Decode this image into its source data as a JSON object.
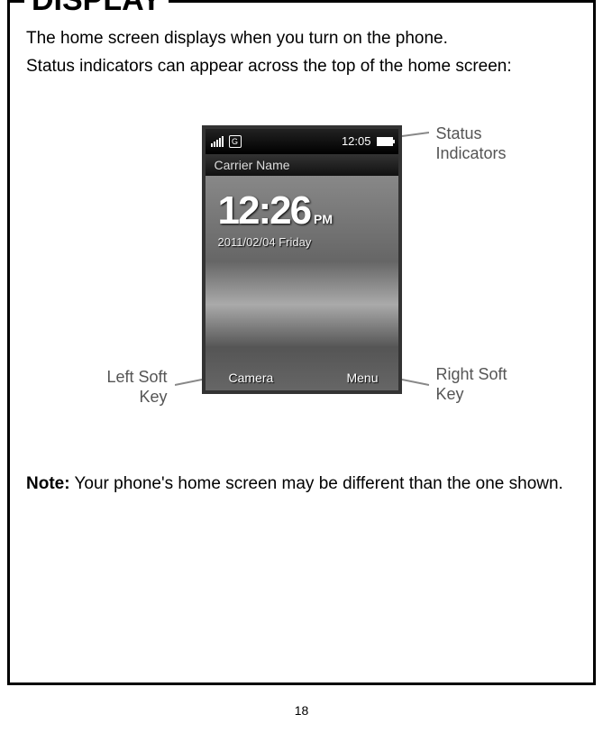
{
  "heading": "DISPLAY",
  "intro_line1": "The home screen displays when you turn on the phone.",
  "intro_line2": "Status indicators can appear across the top of the home screen:",
  "labels": {
    "status_indicators_l1": "Status",
    "status_indicators_l2": "Indicators",
    "left_soft_l1": "Left Soft",
    "left_soft_l2": "Key",
    "right_soft_l1": "Right Soft",
    "right_soft_l2": "Key"
  },
  "phone": {
    "status_time": "12:05",
    "carrier": "Carrier Name",
    "clock_time": "12:26",
    "clock_ampm": "PM",
    "date": "2011/02/04  Friday",
    "left_soft": "Camera",
    "right_soft": "Menu",
    "g_label": "G"
  },
  "note_bold": "Note:",
  "note_rest": " Your phone's home screen may be different than the one shown.",
  "page_number": "18"
}
